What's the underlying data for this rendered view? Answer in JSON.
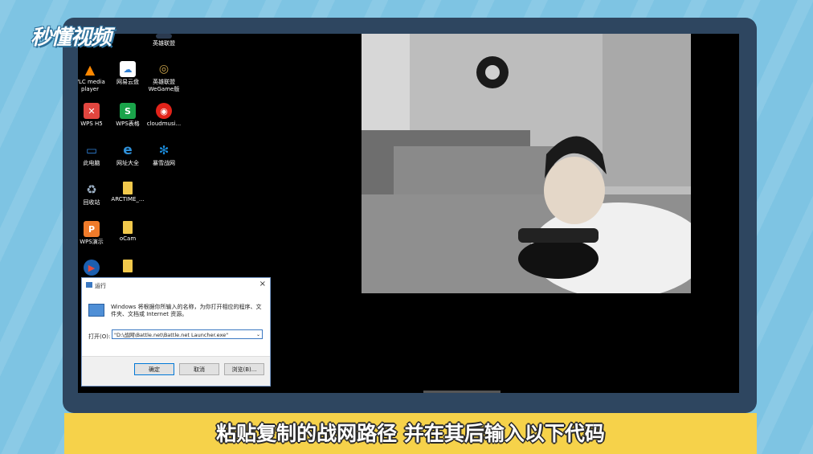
{
  "logo": {
    "text": "秒懂视频"
  },
  "desktop": {
    "icons": [
      {
        "label": "英雄联盟",
        "icon": "league-of-legends-icon",
        "color": "#2b3a4f"
      },
      {
        "label": "VLC media player",
        "icon": "vlc-icon",
        "color": "#ff8800"
      },
      {
        "label": "网易云盘",
        "icon": "netease-cloud-disk-icon",
        "color": "#ffffff"
      },
      {
        "label": "英雄联盟 WeGame版",
        "icon": "wegame-lol-icon",
        "color": "#2b3a4f"
      },
      {
        "label": "WPS H5",
        "icon": "wps-h5-icon",
        "color": "#e2463f"
      },
      {
        "label": "WPS表格",
        "icon": "wps-sheet-icon",
        "color": "#1aa34a"
      },
      {
        "label": "cloudmusi...",
        "icon": "cloudmusic-icon",
        "color": "#e2231a"
      },
      {
        "label": "此电脑",
        "icon": "this-pc-icon",
        "color": "#2f7fd4"
      },
      {
        "label": "网址大全",
        "icon": "ie-browser-icon",
        "color": "#2f90d8"
      },
      {
        "label": "暴雪战网",
        "icon": "battlenet-icon",
        "color": "#1c8fe0"
      },
      {
        "label": "回收站",
        "icon": "recycle-bin-icon",
        "color": "#9fb3c8"
      },
      {
        "label": "ARCTIME_...",
        "icon": "folder-icon",
        "color": "#f2c94c"
      },
      {
        "label": "WPS演示",
        "icon": "wps-presentation-icon",
        "color": "#f07b2a"
      },
      {
        "label": "oCam",
        "icon": "folder-icon",
        "color": "#f2c94c"
      },
      {
        "label": "",
        "icon": "player-icon",
        "color": "#e84b3c"
      },
      {
        "label": "",
        "icon": "folder-icon",
        "color": "#f2c94c"
      }
    ]
  },
  "run_dialog": {
    "title": "运行",
    "close": "×",
    "description": "Windows 将根据你所输入的名称，为你打开相应的程序、文件夹、文档或 Internet 资源。",
    "open_label": "打开(O):",
    "input_value": "\"D:\\战网\\Battle.net\\Battle.net Launcher.exe\"",
    "ok": "确定",
    "cancel": "取消",
    "browse": "浏览(B)..."
  },
  "caption": {
    "text": "粘贴复制的战网路径 并在其后输入以下代码"
  },
  "colors": {
    "caption_bg": "#f6d24a",
    "monitor": "#2e4660",
    "background": "#7ec4e3"
  }
}
